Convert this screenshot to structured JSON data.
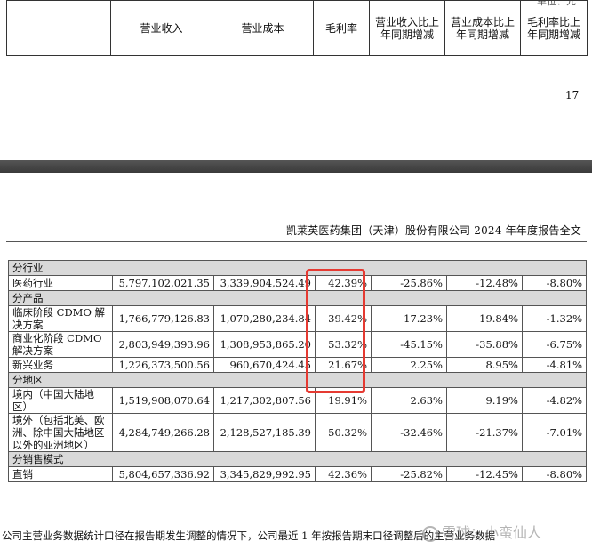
{
  "top_table": {
    "unit_fragment": "单位：元",
    "headers": [
      "营业收入",
      "营业成本",
      "毛利率",
      "营业收入比上年同期增减",
      "营业成本比上年同期增减",
      "毛利率比上年同期增减"
    ]
  },
  "page_number": "17",
  "doc_header": "凯莱英医药集团（天津）股份有限公司 2024 年年度报告全文",
  "sections": [
    {
      "title": "分行业",
      "rows": [
        {
          "name": "医药行业",
          "revenue": "5,797,102,021.35",
          "cost": "3,339,904,524.49",
          "margin": "42.39%",
          "rev_change": "-25.86%",
          "cost_change": "-12.48%",
          "margin_change": "-8.80%"
        }
      ]
    },
    {
      "title": "分产品",
      "rows": [
        {
          "name": "临床阶段 CDMO 解决方案",
          "revenue": "1,766,779,126.83",
          "cost": "1,070,280,234.84",
          "margin": "39.42%",
          "rev_change": "17.23%",
          "cost_change": "19.84%",
          "margin_change": "-1.32%"
        },
        {
          "name": "商业化阶段 CDMO 解决方案",
          "revenue": "2,803,949,393.96",
          "cost": "1,308,953,865.20",
          "margin": "53.32%",
          "rev_change": "-45.15%",
          "cost_change": "-35.88%",
          "margin_change": "-6.75%"
        },
        {
          "name": "新兴业务",
          "revenue": "1,226,373,500.56",
          "cost": "960,670,424.45",
          "margin": "21.67%",
          "rev_change": "2.25%",
          "cost_change": "8.95%",
          "margin_change": "-4.81%"
        }
      ]
    },
    {
      "title": "分地区",
      "rows": [
        {
          "name": "境内（中国大陆地区）",
          "revenue": "1,519,908,070.64",
          "cost": "1,217,302,807.56",
          "margin": "19.91%",
          "rev_change": "2.63%",
          "cost_change": "9.19%",
          "margin_change": "-4.82%"
        },
        {
          "name": "境外（包括北美、欧洲、除中国大陆地区以外的亚洲地区）",
          "revenue": "4,284,749,266.28",
          "cost": "2,128,527,185.39",
          "margin": "50.32%",
          "rev_change": "-32.46%",
          "cost_change": "-21.37%",
          "margin_change": "-7.01%"
        }
      ]
    },
    {
      "title": "分销售模式",
      "rows": [
        {
          "name": "直销",
          "revenue": "5,804,657,336.92",
          "cost": "3,345,829,992.95",
          "margin": "42.36%",
          "rev_change": "-25.82%",
          "cost_change": "-12.45%",
          "margin_change": "-8.80%"
        }
      ]
    }
  ],
  "footer_note": "公司主营业务数据统计口径在报告期发生调整的情况下，公司最近 1 年按报告期末口径调整后的主营业务数据",
  "watermark": "雪球：小蛮仙人",
  "colors": {
    "highlight": "#e53a32",
    "section_bg": "#d9d9d9",
    "divider": "#444444"
  }
}
